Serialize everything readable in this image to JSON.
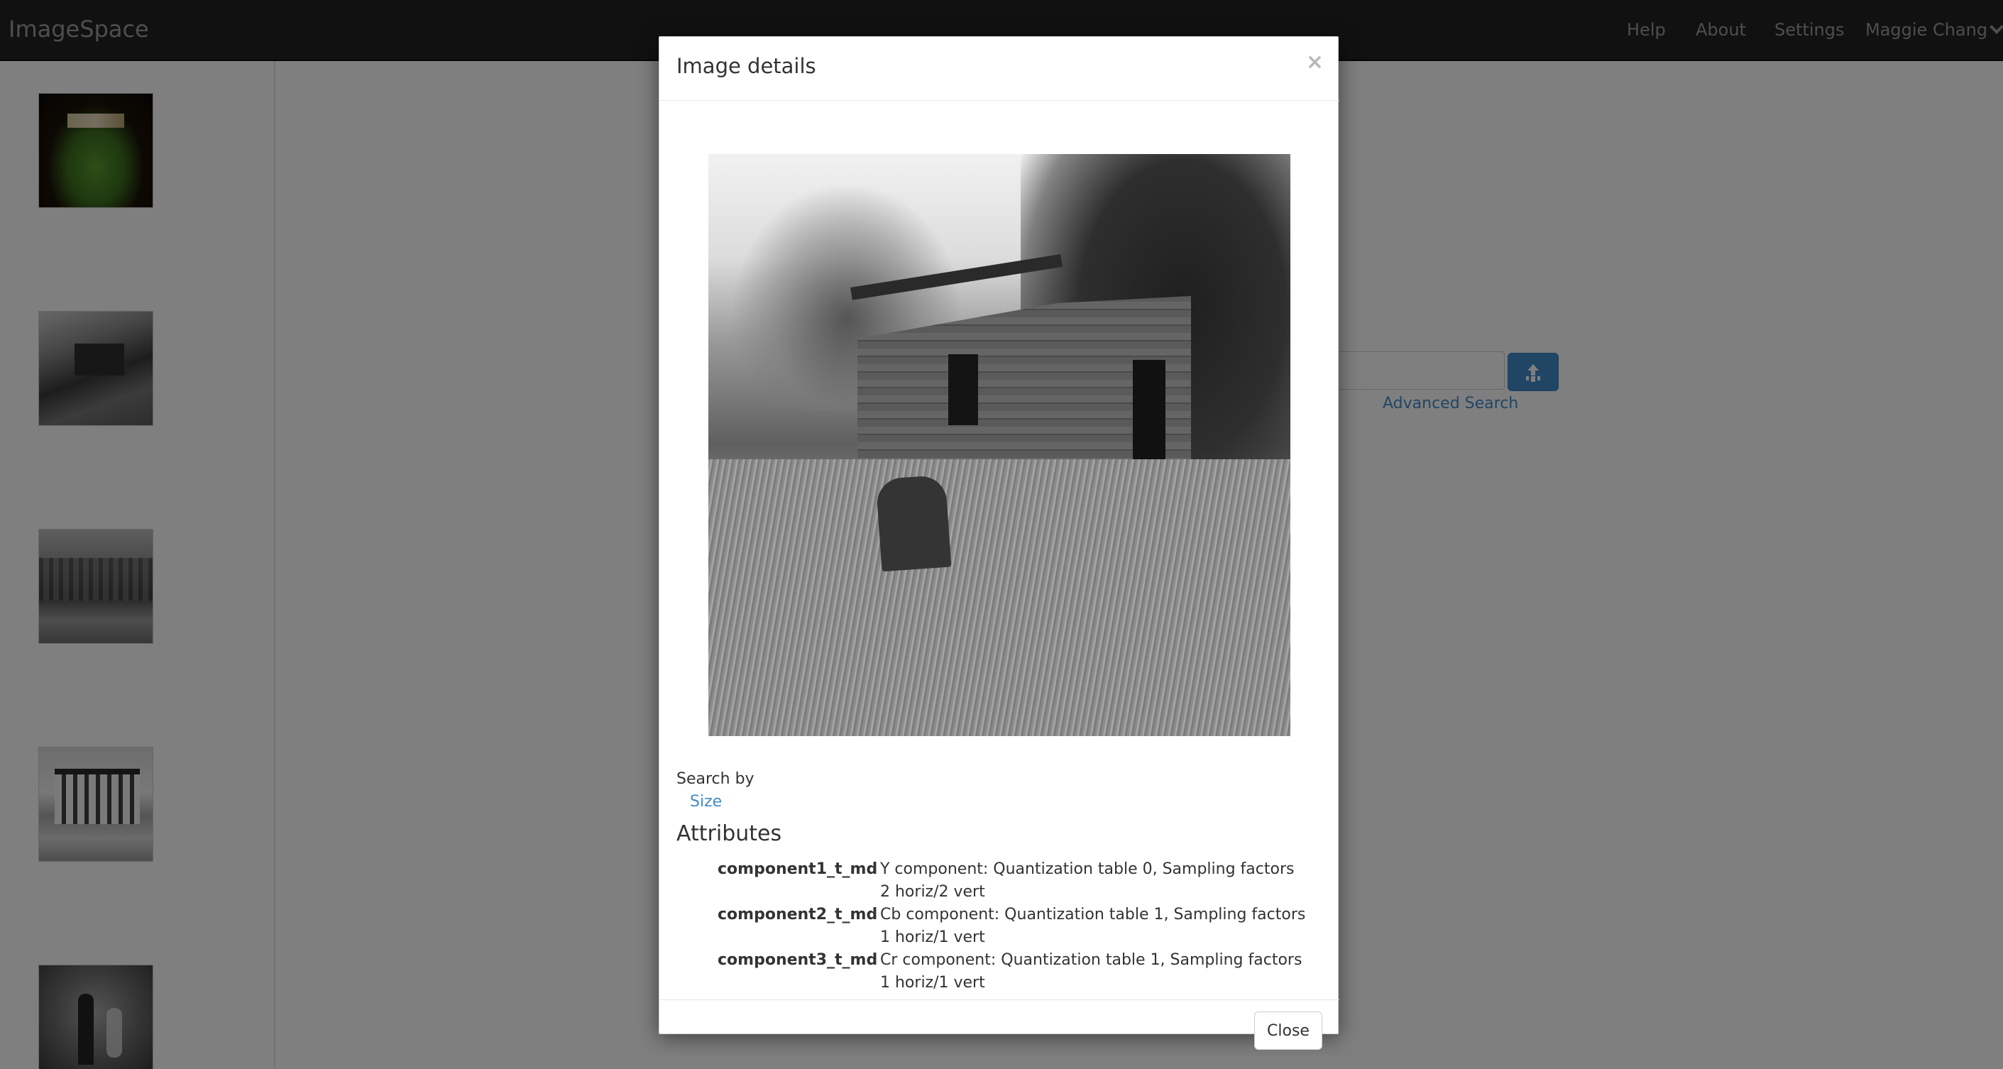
{
  "navbar": {
    "brand": "ImageSpace",
    "links": {
      "help": "Help",
      "about": "About",
      "settings": "Settings"
    },
    "user": "Maggie Chang"
  },
  "sidebar": {
    "thumbnails": [
      {
        "subject": "stadium"
      },
      {
        "subject": "house-graveyard"
      },
      {
        "subject": "misty-forest"
      },
      {
        "subject": "white-building"
      },
      {
        "subject": "figures"
      }
    ]
  },
  "search": {
    "advanced_label": "Advanced Search",
    "upload_icon": "upload-icon"
  },
  "modal": {
    "title": "Image details",
    "close_x": "×",
    "search_by_label": "Search by",
    "search_by_options": [
      "Size"
    ],
    "attributes_heading": "Attributes",
    "attributes": [
      {
        "key": "component1_t_md",
        "value": "Y component: Quantization table 0, Sampling factors 2 horiz/2 vert"
      },
      {
        "key": "component2_t_md",
        "value": "Cb component: Quantization table 1, Sampling factors 1 horiz/1 vert"
      },
      {
        "key": "component3_t_md",
        "value": "Cr component: Quantization table 1, Sampling factors 1 horiz/1 vert"
      }
    ],
    "close_button": "Close"
  },
  "colors": {
    "navbar_bg": "#222222",
    "link": "#428bca",
    "primary_button": "#428bca"
  }
}
